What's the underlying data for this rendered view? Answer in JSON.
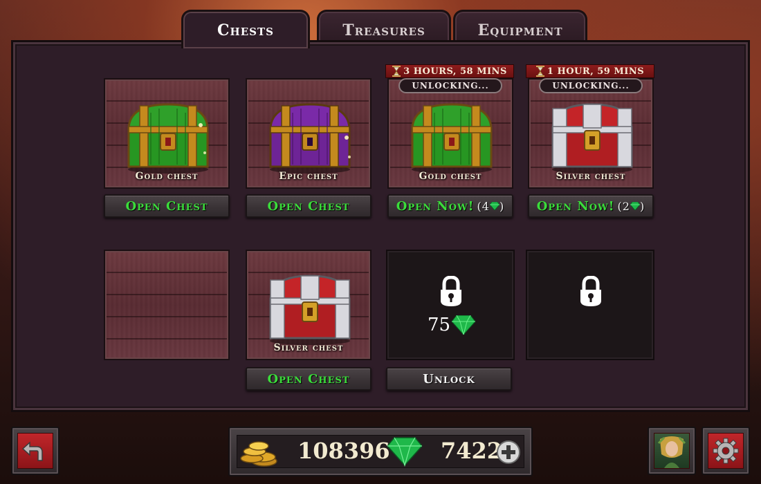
{
  "tabs": [
    {
      "label": "Chests",
      "active": true
    },
    {
      "label": "Treasures",
      "active": false
    },
    {
      "label": "Equipment",
      "active": false
    }
  ],
  "slots": [
    {
      "name": "Gold chest",
      "chest": "gold",
      "button": "Open Chest"
    },
    {
      "name": "Epic chest",
      "chest": "epic",
      "button": "Open Chest"
    },
    {
      "name": "Gold chest",
      "chest": "gold",
      "timer": "3 HOURS, 58 MINS",
      "status": "UNLOCKING...",
      "button": "Open Now!",
      "cost": "4"
    },
    {
      "name": "Silver chest",
      "chest": "silver",
      "timer": "1 HOUR, 59 MINS",
      "status": "UNLOCKING...",
      "button": "Open Now!",
      "cost": "2"
    },
    {
      "name": "",
      "chest": "none"
    },
    {
      "name": "Silver chest",
      "chest": "silver",
      "button": "Open Chest"
    },
    {
      "locked": true,
      "unlock_cost": "75",
      "button": "Unlock"
    },
    {
      "locked": true
    }
  ],
  "currency": {
    "gold": "108396",
    "gems": "7422"
  },
  "colors": {
    "button_green": "#3bdc3b",
    "timer_red": "#8e1c1c",
    "gem_green": "#1fb84a",
    "panel": "#2e1d28"
  },
  "icons": {
    "back": "back-arrow-icon",
    "settings": "gear-icon",
    "hero": "hero-portrait",
    "gold": "gold-coins-icon",
    "gem": "gem-icon",
    "add": "plus-icon",
    "lock": "padlock-icon",
    "timer": "hourglass-icon"
  }
}
